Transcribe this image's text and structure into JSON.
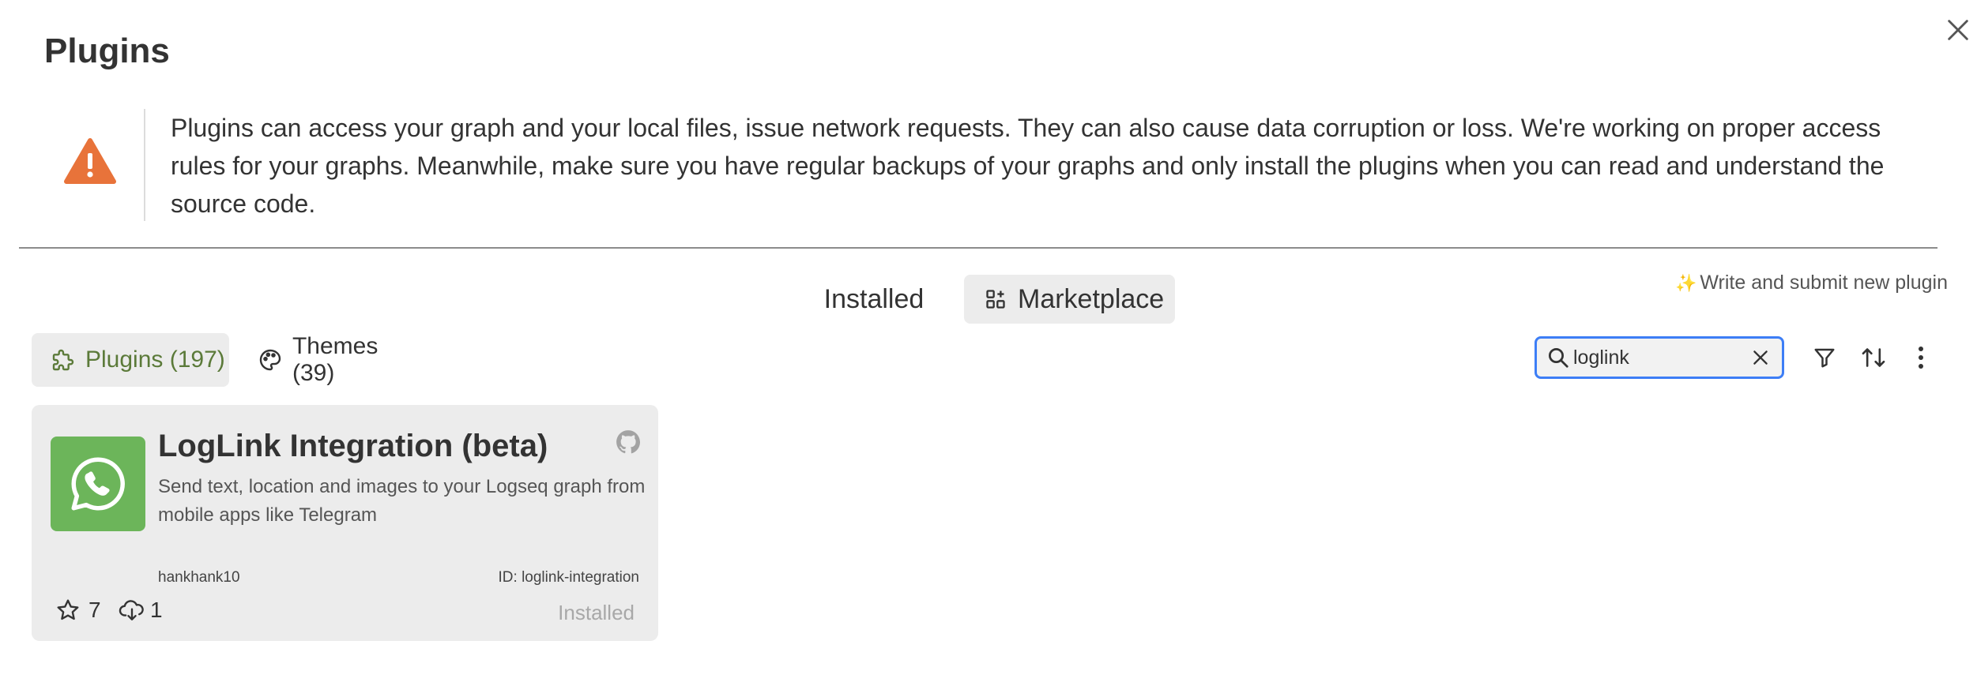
{
  "header": {
    "title": "Plugins"
  },
  "warning": {
    "text": "Plugins can access your graph and your local files, issue network requests. They can also cause data corruption or loss. We're working on proper access rules for your graphs. Meanwhile, make sure you have regular backups of your graphs and only install the plugins when you can read and understand the source code."
  },
  "tabs": {
    "installed": "Installed",
    "marketplace": "Marketplace"
  },
  "submit_link": {
    "label": "Write and submit new plugin",
    "icon": "sparkles-icon"
  },
  "subtabs": {
    "plugins": "Plugins (197)",
    "themes": "Themes (39)"
  },
  "search": {
    "value": "loglink",
    "placeholder": ""
  },
  "plugins": [
    {
      "name": "LogLink Integration (beta)",
      "description": "Send text, location and images to your Logseq graph from mobile apps like Telegram",
      "author": "hankhank10",
      "id_label": "ID: loglink-integration",
      "stars": "7",
      "downloads": "1",
      "status": "Installed"
    }
  ],
  "colors": {
    "accent": "#3d7ef6",
    "warning": "#e8733a",
    "plugin_icon_bg": "#6cb55a",
    "active_subtab_text": "#5b7a39"
  }
}
